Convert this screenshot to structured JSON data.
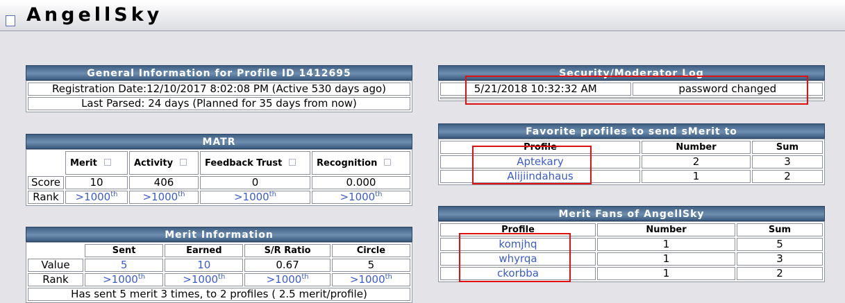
{
  "header": {
    "title": "AngellSky"
  },
  "general": {
    "title": "General Information for Profile ID 1412695",
    "registration": "Registration Date:12/10/2017 8:02:08 PM (Active 530 days ago)",
    "last_parsed": "Last Parsed: 24 days (Planned for 35 days from now)"
  },
  "matr": {
    "title": "MATR",
    "columns": [
      "Merit",
      "Activity",
      "Feedback Trust",
      "Recognition"
    ],
    "score_label": "Score",
    "rank_label": "Rank",
    "scores": [
      "10",
      "406",
      "0",
      "0.000"
    ],
    "ranks": [
      ">1000",
      ">1000",
      ">1000",
      ">1000"
    ],
    "rank_sup": "th"
  },
  "merit_info": {
    "title": "Merit Information",
    "columns": [
      "Sent",
      "Earned",
      "S/R Ratio",
      "Circle"
    ],
    "value_label": "Value",
    "rank_label": "Rank",
    "values": [
      "5",
      "10",
      "0.67",
      "5"
    ],
    "ranks": [
      ">1000",
      ">1000",
      ">1000",
      ">1000"
    ],
    "rank_sup": "th",
    "summary": "Has sent 5 merit 3 times, to 2 profiles ( 2.5 merit/profile)"
  },
  "security": {
    "title": "Security/Moderator Log",
    "rows": [
      {
        "date": "5/21/2018 10:32:32 AM",
        "event": "password changed"
      }
    ]
  },
  "favorites": {
    "title": "Favorite profiles to send sMerit to",
    "columns": [
      "Profile",
      "Number",
      "Sum"
    ],
    "rows": [
      {
        "profile": "Aptekary",
        "number": "2",
        "sum": "3"
      },
      {
        "profile": "Alijiindahaus",
        "number": "1",
        "sum": "2"
      }
    ]
  },
  "fans": {
    "title": "Merit Fans of AngellSky",
    "columns": [
      "Profile",
      "Number",
      "Sum"
    ],
    "rows": [
      {
        "profile": "komjhq",
        "number": "1",
        "sum": "5"
      },
      {
        "profile": "whyrqa",
        "number": "1",
        "sum": "3"
      },
      {
        "profile": "ckorbba",
        "number": "1",
        "sum": "2"
      }
    ]
  },
  "colors": {
    "link": "#3a5bd0",
    "panel_header": "#4a6a90",
    "highlight": "#e01010"
  }
}
